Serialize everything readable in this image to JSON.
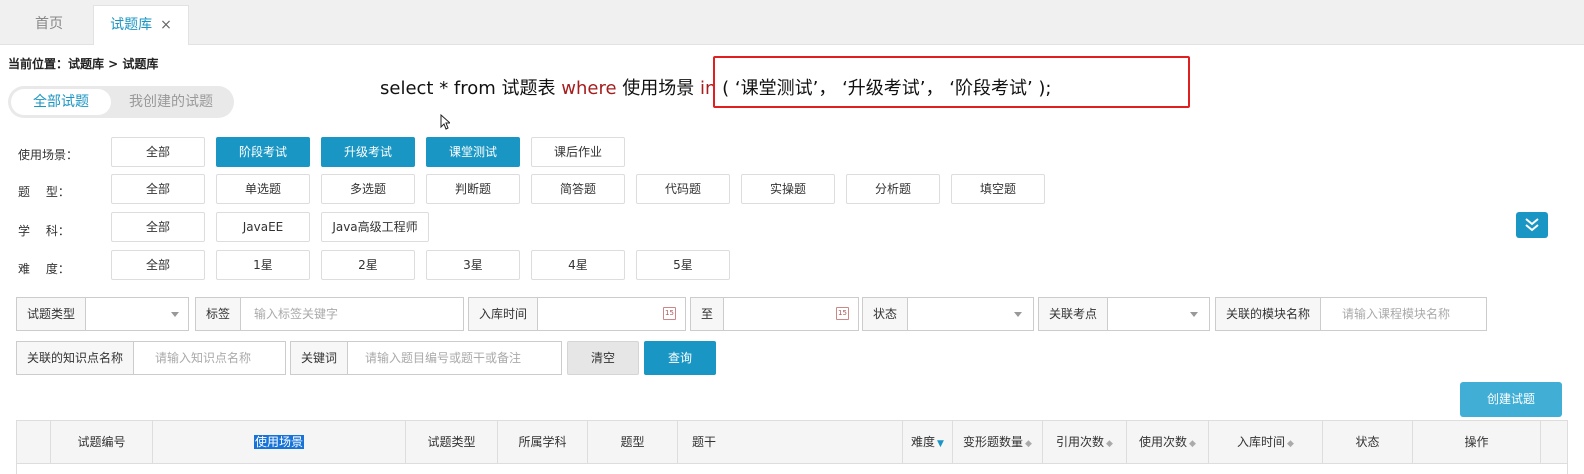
{
  "tabs": [
    {
      "label": "首页"
    },
    {
      "label": "试题库",
      "close": "×"
    }
  ],
  "breadcrumb": "当前位置：试题库 > 试题库",
  "segment": {
    "all": "全部试题",
    "mine": "我创建的试题"
  },
  "sql": {
    "p1": "select * from 试题表 ",
    "kw1": "where",
    "p2": " 使用场景 ",
    "kw2": "in",
    "p3": " ( ‘课堂测试’， ‘升级考试’， ‘阶段考试’ );"
  },
  "filters": {
    "scene": {
      "label": "使用场景：",
      "options": [
        "全部",
        "阶段考试",
        "升级考试",
        "课堂测试",
        "课后作业"
      ]
    },
    "type": {
      "label": "题　 型：",
      "options": [
        "全部",
        "单选题",
        "多选题",
        "判断题",
        "简答题",
        "代码题",
        "实操题",
        "分析题",
        "填空题"
      ]
    },
    "subject": {
      "label": "学　 科：",
      "options": [
        "全部",
        "JavaEE",
        "Java高级工程师"
      ]
    },
    "difficulty": {
      "label": "难　 度：",
      "options": [
        "全部",
        "1星",
        "2星",
        "3星",
        "4星",
        "5星"
      ]
    }
  },
  "form": {
    "qtype": {
      "label": "试题类型",
      "value": ""
    },
    "tag": {
      "label": "标签",
      "placeholder": "输入标签关键字"
    },
    "intime": {
      "label": "入库时间",
      "to": "至",
      "cal": "15"
    },
    "status": {
      "label": "状态",
      "value": ""
    },
    "point": {
      "label": "关联考点",
      "value": ""
    },
    "module": {
      "label": "关联的模块名称",
      "placeholder": "请输入课程模块名称"
    },
    "knowledge": {
      "label": "关联的知识点名称",
      "placeholder": "请输入知识点名称"
    },
    "keyword": {
      "label": "关键词",
      "placeholder": "请输入题目编号或题干或备注"
    }
  },
  "buttons": {
    "clear": "清空",
    "query": "查询",
    "create": "创建试题"
  },
  "table": {
    "columns": [
      "试题编号",
      "使用场景",
      "试题类型",
      "所属学科",
      "题型",
      "题干",
      "难度",
      "变形题数量",
      "引用次数",
      "使用次数",
      "入库时间",
      "状态",
      "操作"
    ]
  },
  "colors": {
    "accent": "#1a96c4",
    "sql_keyword": "#a51d1d",
    "highlight_box": "#e02020"
  }
}
